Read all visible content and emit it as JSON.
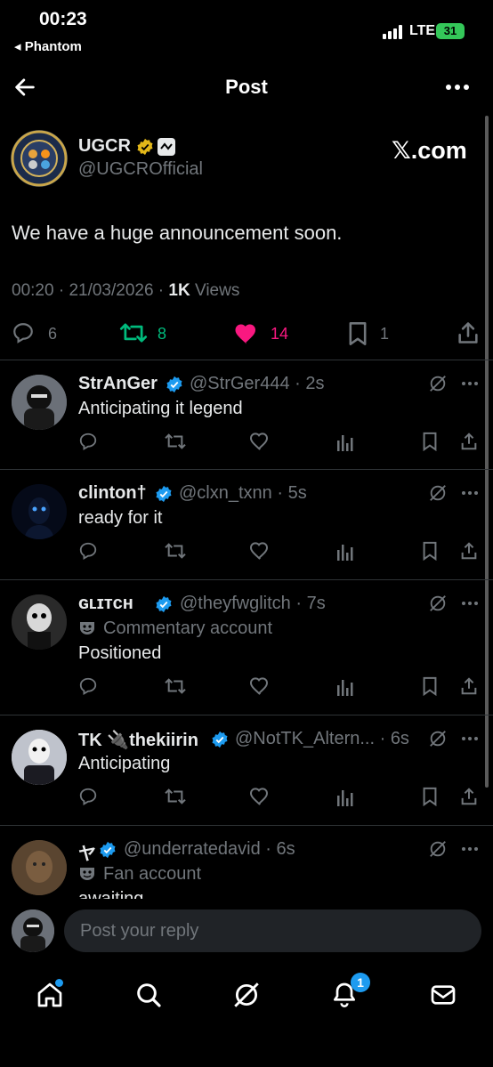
{
  "status_bar": {
    "time": "00:23",
    "back_app": "Phantom",
    "network": "LTE",
    "battery": "31"
  },
  "nav": {
    "title": "Post"
  },
  "post": {
    "author_name": "UGCR",
    "author_handle": "@UGCROfficial",
    "brand": "𝕏.com",
    "text": "We have a huge announcement soon.",
    "time": "00:20",
    "date": "21/03/2026",
    "views_count": "1K",
    "views_label": "Views",
    "replies": "6",
    "reposts": "8",
    "likes": "14",
    "bookmarks": "1",
    "colors": {
      "repost": "#00ba7c",
      "like": "#f91880",
      "verified_gold": "#e2b719",
      "verified_blue": "#1d9bf0"
    }
  },
  "replies": [
    {
      "name": "StrAnGer",
      "handle": "@StrGer444",
      "time": "2s",
      "text": "Anticipating it legend"
    },
    {
      "name": "clinton†",
      "handle": "@clxn_txnn",
      "time": "5s",
      "text": "ready for it"
    },
    {
      "name": "ɢʟɪᴛᴄʜ",
      "handle": "@theyfwglitch",
      "time": "7s",
      "tag": "Commentary account",
      "text": "Positioned"
    },
    {
      "name": "TK 🔌thekiirin",
      "handle": "@NotTK_Altern...",
      "time": "6s",
      "text": "Anticipating"
    },
    {
      "name": "ヤ",
      "handle": "@underratedavid",
      "time": "6s",
      "tag": "Fan account",
      "text": "awaiting"
    }
  ],
  "composer": {
    "placeholder": "Post your reply"
  },
  "tabbar": {
    "notifications_badge": "1"
  }
}
